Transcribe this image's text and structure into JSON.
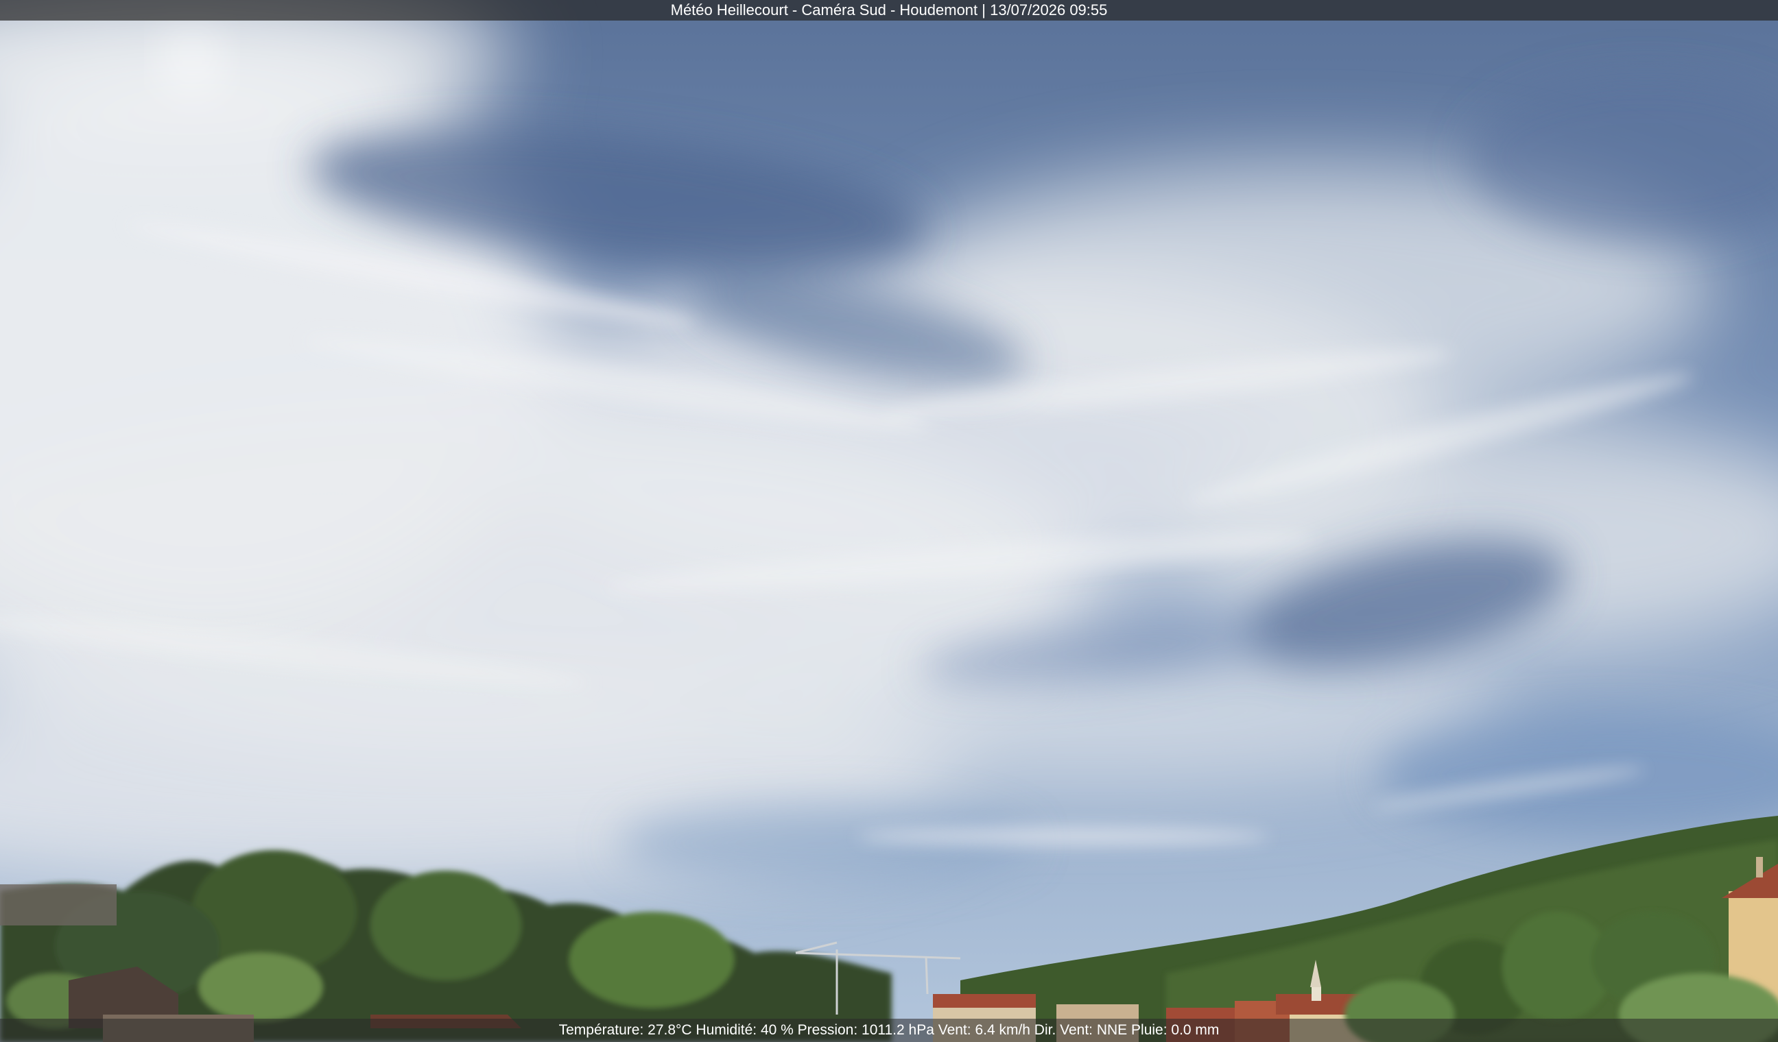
{
  "camera": {
    "caption": "Météo Heillecourt - Caméra Sud - Houdemont | 13/07/2026 09:55"
  },
  "weather": {
    "readout": "Température: 27.8°C  Humidité: 40 % Pression: 1011.2 hPa Vent: 6.4 km/h Dir. Vent: NNE Pluie: 0.0 mm"
  },
  "colors": {
    "sky_deep": "#4f6a96",
    "sky_mid": "#7f9ac0",
    "sky_low": "#a9bfd9",
    "cloud": "#e9ecef",
    "trees_dark": "#2f4423",
    "trees_light": "#5c7d3b",
    "hill": "#3f5d2b",
    "roof": "#9c4a34",
    "wall": "#e3c58c"
  }
}
